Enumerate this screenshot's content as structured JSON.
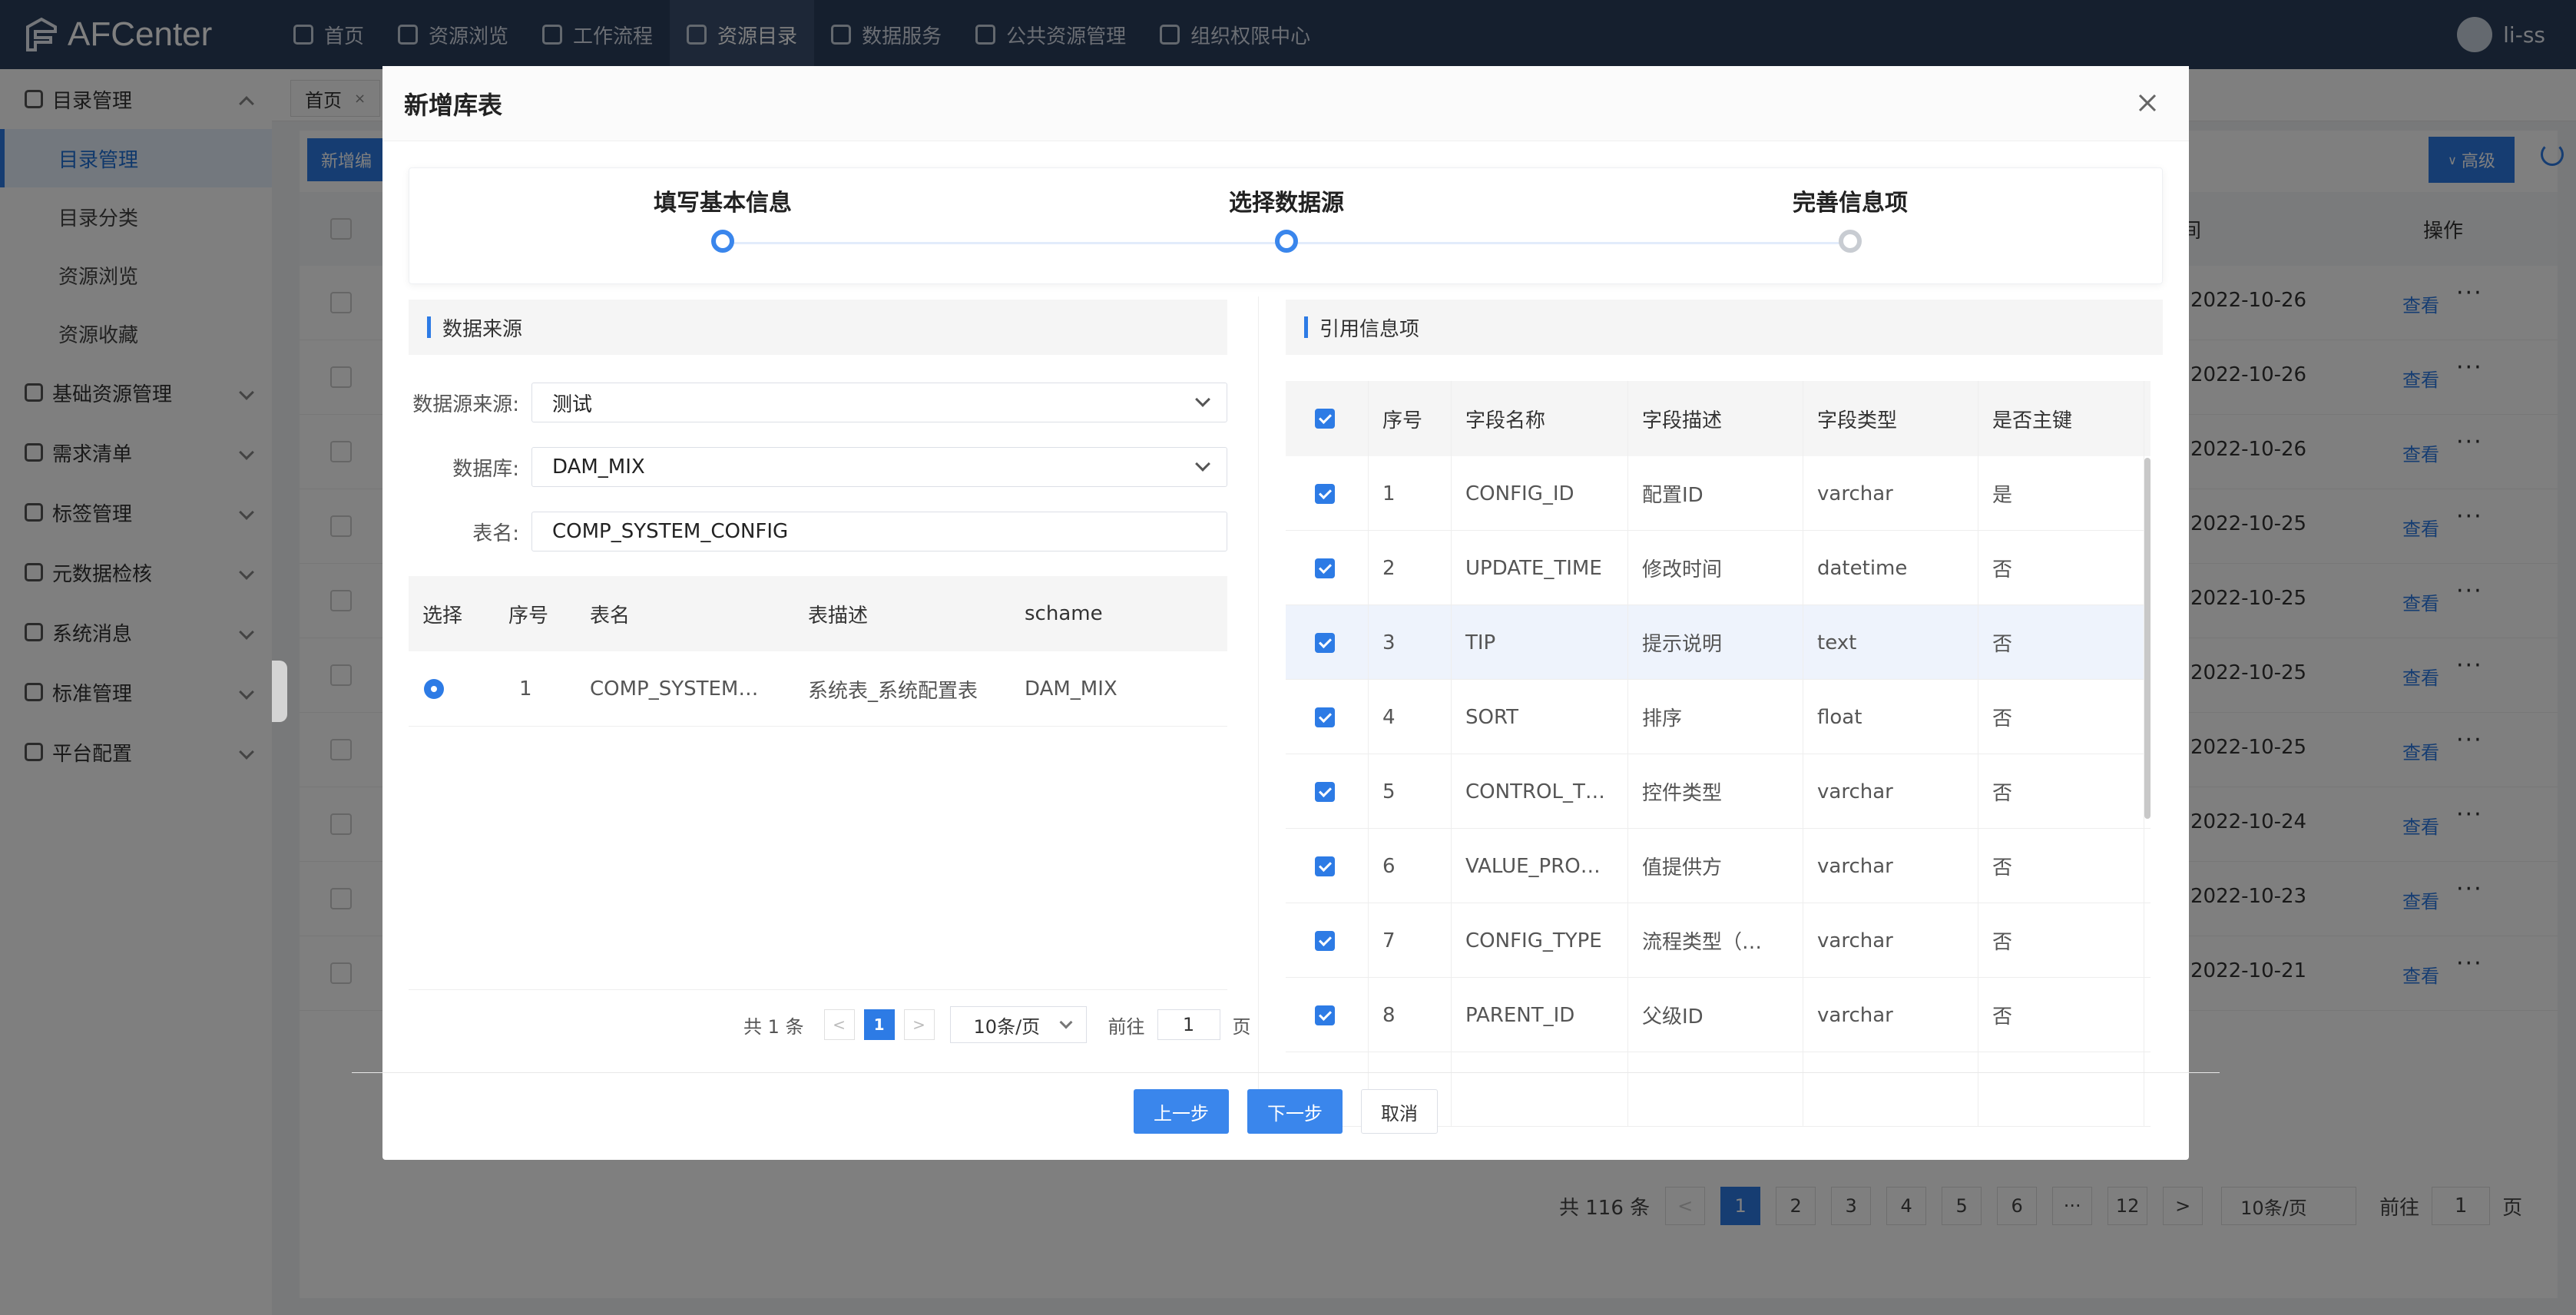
{
  "app": {
    "title": "AFCenter",
    "user": "li-ss"
  },
  "nav": [
    {
      "label": "首页",
      "icon": "home-icon"
    },
    {
      "label": "资源浏览",
      "icon": "browse-icon"
    },
    {
      "label": "工作流程",
      "icon": "workflow-icon"
    },
    {
      "label": "资源目录",
      "icon": "folder-icon",
      "active": true
    },
    {
      "label": "数据服务",
      "icon": "service-icon"
    },
    {
      "label": "公共资源管理",
      "icon": "public-icon"
    },
    {
      "label": "组织权限中心",
      "icon": "org-icon"
    }
  ],
  "sidebar": {
    "group_main": "目录管理",
    "items": [
      "目录管理",
      "目录分类",
      "资源浏览",
      "资源收藏"
    ],
    "groups": [
      "基础资源管理",
      "需求清单",
      "标签管理",
      "元数据检核",
      "系统消息",
      "标准管理",
      "平台配置"
    ]
  },
  "background": {
    "tab_home": "首页",
    "btn_new": "新增编",
    "btn_adv": "高级",
    "col_time": "间",
    "col_op": "操作",
    "view_label": "查看",
    "more_label": "···",
    "dates": [
      "2022-10-26",
      "2022-10-26",
      "2022-10-26",
      "2022-10-25",
      "2022-10-25",
      "2022-10-25",
      "2022-10-25",
      "2022-10-24",
      "2022-10-23",
      "2022-10-21"
    ],
    "pager": {
      "total": "共 116 条",
      "pages": [
        "1",
        "2",
        "3",
        "4",
        "5",
        "6",
        "···",
        "12"
      ],
      "size": "10条/页",
      "goto": "前往",
      "goto_val": "1",
      "page_unit": "页",
      "next": ">",
      "prev": "<"
    }
  },
  "modal": {
    "title": "新增库表",
    "steps": [
      {
        "label": "填写基本信息",
        "state": "done"
      },
      {
        "label": "选择数据源",
        "state": "current"
      },
      {
        "label": "完善信息项",
        "state": "pending"
      }
    ],
    "left_section": "数据来源",
    "right_section": "引用信息项",
    "form": {
      "source_label": "数据源来源:",
      "source_value": "测试",
      "db_label": "数据库:",
      "db_value": "DAM_MIX",
      "table_label": "表名:",
      "table_value": "COMP_SYSTEM_CONFIG"
    },
    "left_table": {
      "headers": [
        "选择",
        "序号",
        "表名",
        "表描述",
        "schame"
      ],
      "rows": [
        {
          "no": "1",
          "name": "COMP_SYSTEM…",
          "desc": "系统表_系统配置表",
          "schema": "DAM_MIX"
        }
      ]
    },
    "left_pager": {
      "total": "共 1 条",
      "prev": "<",
      "page": "1",
      "next": ">",
      "size": "10条/页",
      "goto": "前往",
      "goto_val": "1",
      "page_unit": "页"
    },
    "right_table": {
      "headers": [
        "序号",
        "字段名称",
        "字段描述",
        "字段类型",
        "是否主键"
      ],
      "rows": [
        {
          "no": "1",
          "name": "CONFIG_ID",
          "desc": "配置ID",
          "type": "varchar",
          "pk": "是"
        },
        {
          "no": "2",
          "name": "UPDATE_TIME",
          "desc": "修改时间",
          "type": "datetime",
          "pk": "否"
        },
        {
          "no": "3",
          "name": "TIP",
          "desc": "提示说明",
          "type": "text",
          "pk": "否"
        },
        {
          "no": "4",
          "name": "SORT",
          "desc": "排序",
          "type": "float",
          "pk": "否"
        },
        {
          "no": "5",
          "name": "CONTROL_T…",
          "desc": "控件类型",
          "type": "varchar",
          "pk": "否"
        },
        {
          "no": "6",
          "name": "VALUE_PRO…",
          "desc": "值提供方",
          "type": "varchar",
          "pk": "否"
        },
        {
          "no": "7",
          "name": "CONFIG_TYPE",
          "desc": "流程类型（…",
          "type": "varchar",
          "pk": "否"
        },
        {
          "no": "8",
          "name": "PARENT_ID",
          "desc": "父级ID",
          "type": "varchar",
          "pk": "否"
        }
      ]
    },
    "footer": {
      "prev": "上一步",
      "next": "下一步",
      "cancel": "取消"
    }
  }
}
